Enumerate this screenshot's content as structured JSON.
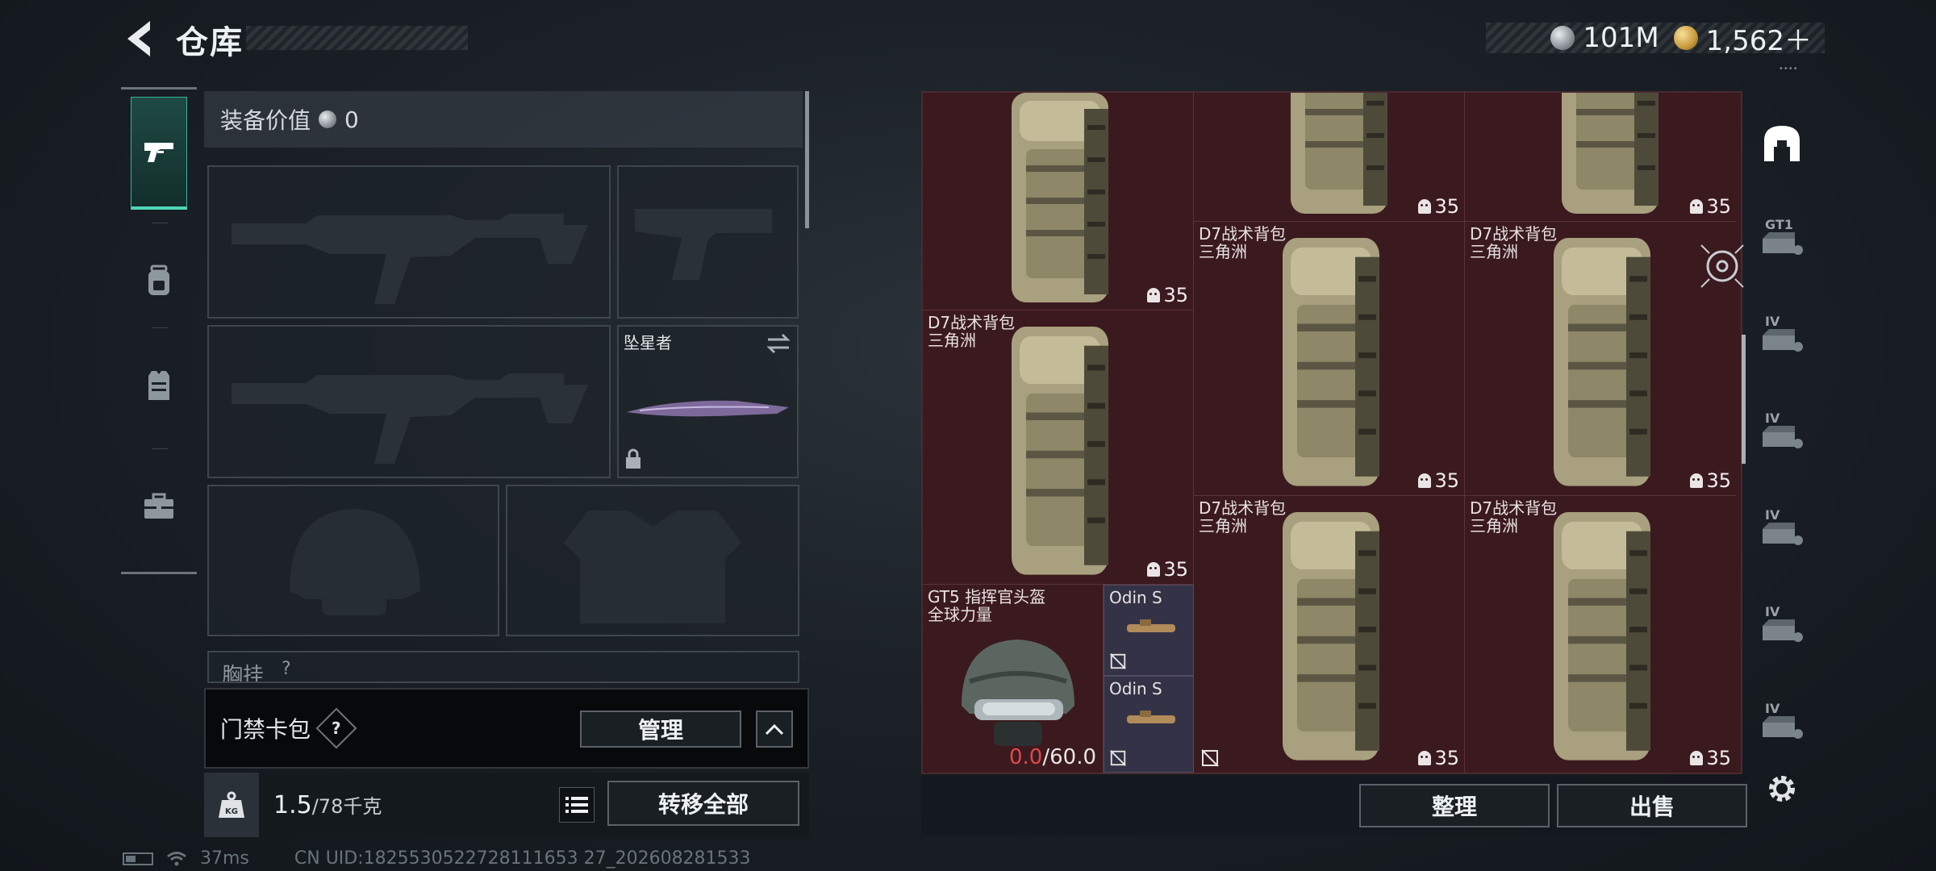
{
  "header": {
    "title": "仓库",
    "currency": [
      {
        "icon": "silver-coin-icon",
        "value": "101M"
      },
      {
        "icon": "gold-coin-icon",
        "value": "1,562＋"
      }
    ],
    "currency_dots": "••••"
  },
  "left_nav": {
    "items": [
      {
        "icon": "pistol-icon",
        "active": true
      },
      {
        "icon": "backpack-icon",
        "active": false
      },
      {
        "icon": "vest-icon",
        "active": false
      },
      {
        "icon": "briefcase-icon",
        "active": false
      }
    ]
  },
  "loadout": {
    "equip_value_label": "装备价值",
    "equip_value": "0",
    "melee_name": "坠星者",
    "chest_rig_label": "胸挂",
    "chest_rig_count": "?",
    "keycard_label": "门禁卡包",
    "keycard_help": "?",
    "manage_label": "管理",
    "weight_current": "1.5",
    "weight_max": "/78千克",
    "weight_icon_text": "KG",
    "transfer_all_label": "转移全部"
  },
  "inventory": {
    "items": [
      {
        "name": "",
        "sub": "",
        "count": "35"
      },
      {
        "name": "",
        "sub": "",
        "count": "35"
      },
      {
        "name": "",
        "sub": "",
        "count": "35"
      },
      {
        "name": "D7战术背包",
        "sub": "三角洲",
        "count": "35"
      },
      {
        "name": "D7战术背包",
        "sub": "三角洲",
        "count": "35"
      },
      {
        "name": "D7战术背包",
        "sub": "三角洲",
        "count": "35"
      },
      {
        "name": "D7战术背包",
        "sub": "三角洲",
        "count": "35"
      },
      {
        "name": "D7战术背包",
        "sub": "三角洲",
        "count": "35"
      }
    ],
    "helmet": {
      "name": "GT5 指挥官头盔",
      "sub": "全球力量",
      "durability_current": "0.0",
      "durability_max": "/60.0"
    },
    "scopes": [
      {
        "name": "Odin S"
      },
      {
        "name": "Odin S"
      }
    ],
    "sort_label": "整理",
    "sell_label": "出售"
  },
  "right_tabs": [
    {
      "icon": "home-container-icon",
      "label": ""
    },
    {
      "icon": "storage-box-icon",
      "label": "GT1"
    },
    {
      "icon": "storage-box-icon",
      "label": "IV"
    },
    {
      "icon": "storage-box-icon",
      "label": "IV"
    },
    {
      "icon": "storage-box-icon",
      "label": "IV"
    },
    {
      "icon": "storage-box-icon",
      "label": "IV"
    },
    {
      "icon": "storage-box-icon",
      "label": "IV"
    }
  ],
  "status": {
    "ping": "37ms",
    "uid": "CN UID:1825530522728111653 27_202608281533"
  },
  "colors": {
    "accent": "#4fd6b7",
    "inventory_bg": "#3b1a1f",
    "panel_bg": "#1b2127",
    "durability_zero": "#e04848"
  }
}
